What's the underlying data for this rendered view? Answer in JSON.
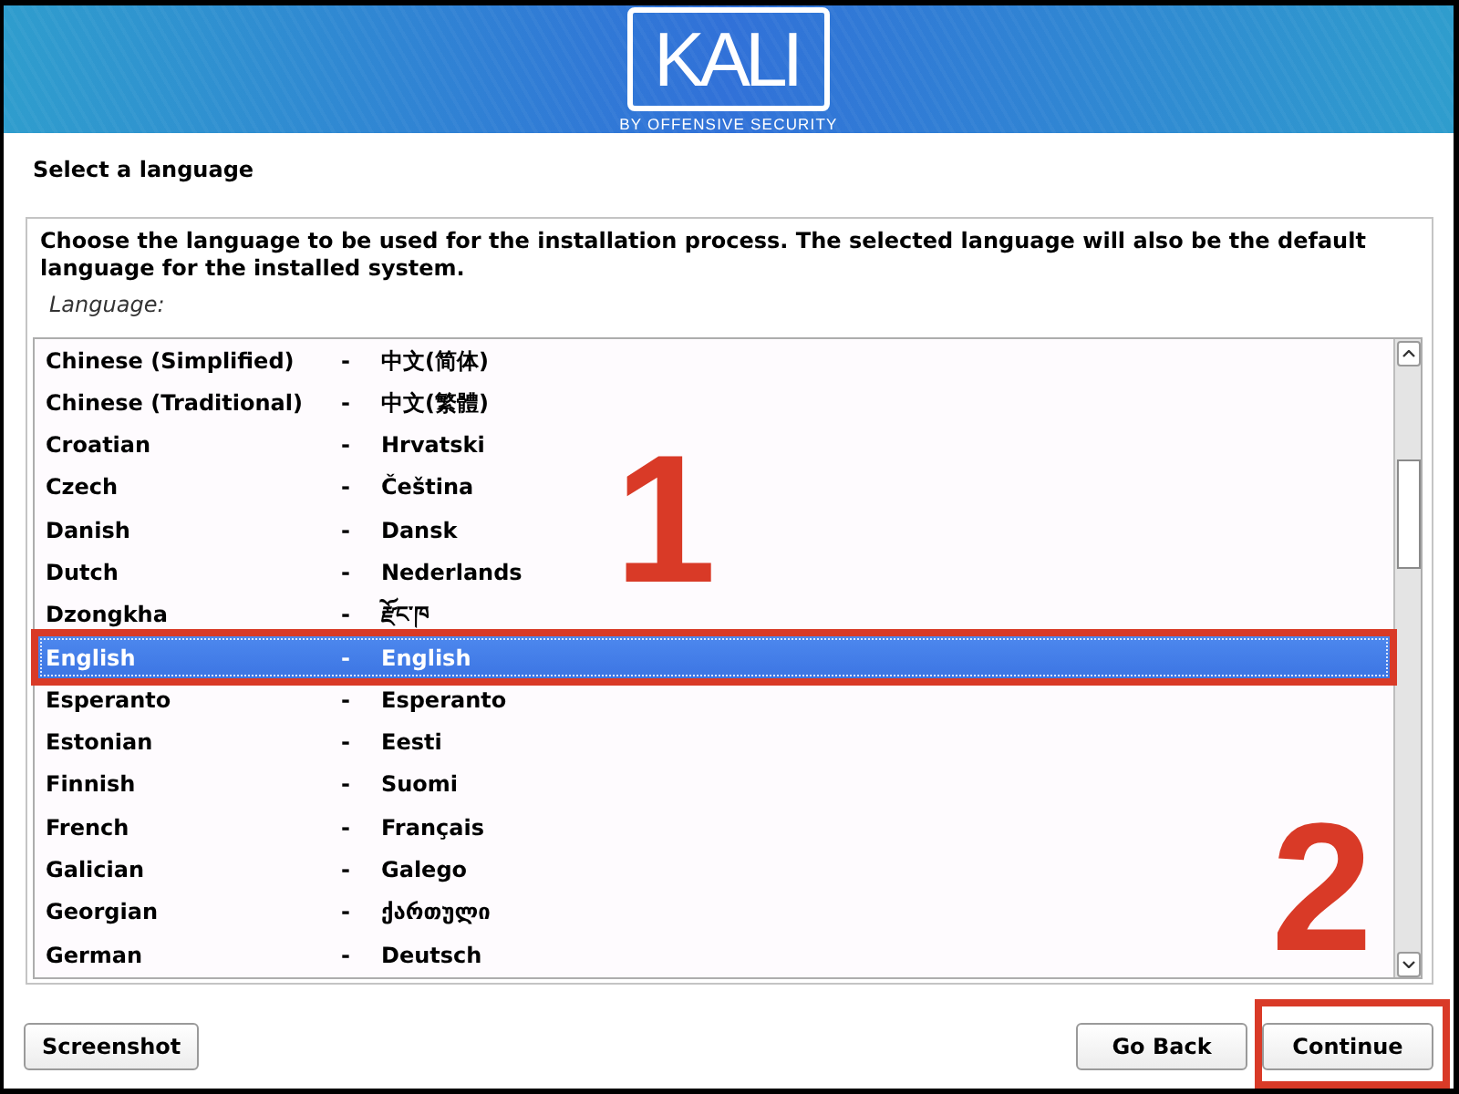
{
  "banner": {
    "logo_text": "KALI",
    "tagline": "BY OFFENSIVE SECURITY"
  },
  "page_title": "Select a language",
  "panel": {
    "description": "Choose the language to be used for the installation process. The selected language will also be the default language for the installed system.",
    "list_label": "Language:",
    "languages": [
      {
        "name": "Chinese (Simplified)",
        "separator": "-",
        "native": "中文(简体)",
        "selected": false,
        "outlined": false
      },
      {
        "name": "Chinese (Traditional)",
        "separator": "-",
        "native": "中文(繁體)",
        "selected": false,
        "outlined": false
      },
      {
        "name": "Croatian",
        "separator": "-",
        "native": "Hrvatski",
        "selected": false,
        "outlined": false
      },
      {
        "name": "Czech",
        "separator": "-",
        "native": "Čeština",
        "selected": false,
        "outlined": false
      },
      {
        "name": "Danish",
        "separator": "-",
        "native": "Dansk",
        "selected": false,
        "outlined": false
      },
      {
        "name": "Dutch",
        "separator": "-",
        "native": "Nederlands",
        "selected": false,
        "outlined": false
      },
      {
        "name": "Dzongkha",
        "separator": "-",
        "native": "རྫོང་ཁ",
        "selected": false,
        "outlined": false
      },
      {
        "name": "English",
        "separator": "-",
        "native": "English",
        "selected": true,
        "outlined": true
      },
      {
        "name": "Esperanto",
        "separator": "-",
        "native": "Esperanto",
        "selected": false,
        "outlined": false
      },
      {
        "name": "Estonian",
        "separator": "-",
        "native": "Eesti",
        "selected": false,
        "outlined": false
      },
      {
        "name": "Finnish",
        "separator": "-",
        "native": "Suomi",
        "selected": false,
        "outlined": false
      },
      {
        "name": "French",
        "separator": "-",
        "native": "Français",
        "selected": false,
        "outlined": false
      },
      {
        "name": "Galician",
        "separator": "-",
        "native": "Galego",
        "selected": false,
        "outlined": false
      },
      {
        "name": "Georgian",
        "separator": "-",
        "native": "ქართული",
        "selected": false,
        "outlined": false
      },
      {
        "name": "German",
        "separator": "-",
        "native": "Deutsch",
        "selected": false,
        "outlined": false
      }
    ]
  },
  "buttons_left": [
    {
      "label": "Screenshot",
      "outlined": false
    }
  ],
  "buttons_right": [
    {
      "label": "Go Back",
      "outlined": false
    },
    {
      "label": "Continue",
      "outlined": true
    }
  ],
  "annotations": [
    {
      "text": "1"
    },
    {
      "text": "2"
    }
  ]
}
